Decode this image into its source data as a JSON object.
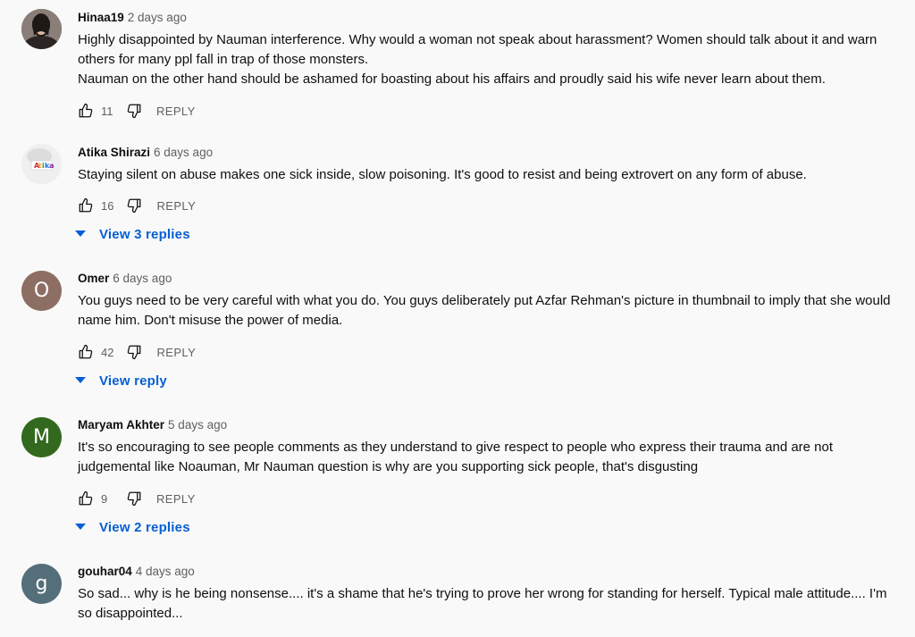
{
  "comments": [
    {
      "author": "Hinaa19",
      "time": "2 days ago",
      "avatar_letter": "",
      "avatar_color": "#6b5a52",
      "lines": [
        "Highly disappointed by Nauman interference. Why would a woman not speak about harassment? Women should talk about it and warn others for many ppl fall in trap of those monsters.",
        "Nauman on the other hand should be ashamed for boasting about his affairs and proudly said his wife never learn about them."
      ],
      "likes": "11",
      "reply_label": "REPLY",
      "view_replies": ""
    },
    {
      "author": "Atika Shirazi",
      "time": "6 days ago",
      "avatar_letter": "",
      "avatar_logo_text": "Atika",
      "avatar_color": "#e8e8e8",
      "lines": [
        "Staying silent on abuse makes one sick inside, slow poisoning. It's  good to resist and being extrovert on any form of abuse."
      ],
      "likes": "16",
      "reply_label": "REPLY",
      "view_replies": "View 3 replies"
    },
    {
      "author": "Omer",
      "time": "6 days ago",
      "avatar_letter": "O",
      "avatar_color": "#8d6e63",
      "lines": [
        "You guys need to be very careful with what you do. You guys deliberately put Azfar Rehman's picture in thumbnail to imply that she would name him. Don't misuse the power of media."
      ],
      "likes": "42",
      "reply_label": "REPLY",
      "view_replies": "View reply"
    },
    {
      "author": "Maryam Akhter",
      "time": "5 days ago",
      "avatar_letter": "M",
      "avatar_color": "#33691e",
      "lines": [
        "It's so encouraging to see people comments as they understand to give respect to people who express their trauma and are not judgemental like Noauman, Mr Nauman question is why are you supporting sick people, that's disgusting"
      ],
      "likes": "9",
      "reply_label": "REPLY",
      "view_replies": "View 2 replies"
    },
    {
      "author": "gouhar04",
      "time": "4 days ago",
      "avatar_letter": "g",
      "avatar_color": "#546e7a",
      "lines": [
        "So sad... why is he being nonsense.... it's a shame that he's trying to prove her wrong for standing for herself. Typical male attitude.... I'm so disappointed..."
      ],
      "likes": "",
      "reply_label": "",
      "view_replies": ""
    }
  ],
  "icons": {
    "like": "thumbs-up-icon",
    "dislike": "thumbs-down-icon",
    "expand": "caret-down-icon"
  },
  "colors": {
    "link_blue": "#065fd4",
    "secondary_text": "#606060",
    "background": "#f9f9f9"
  }
}
